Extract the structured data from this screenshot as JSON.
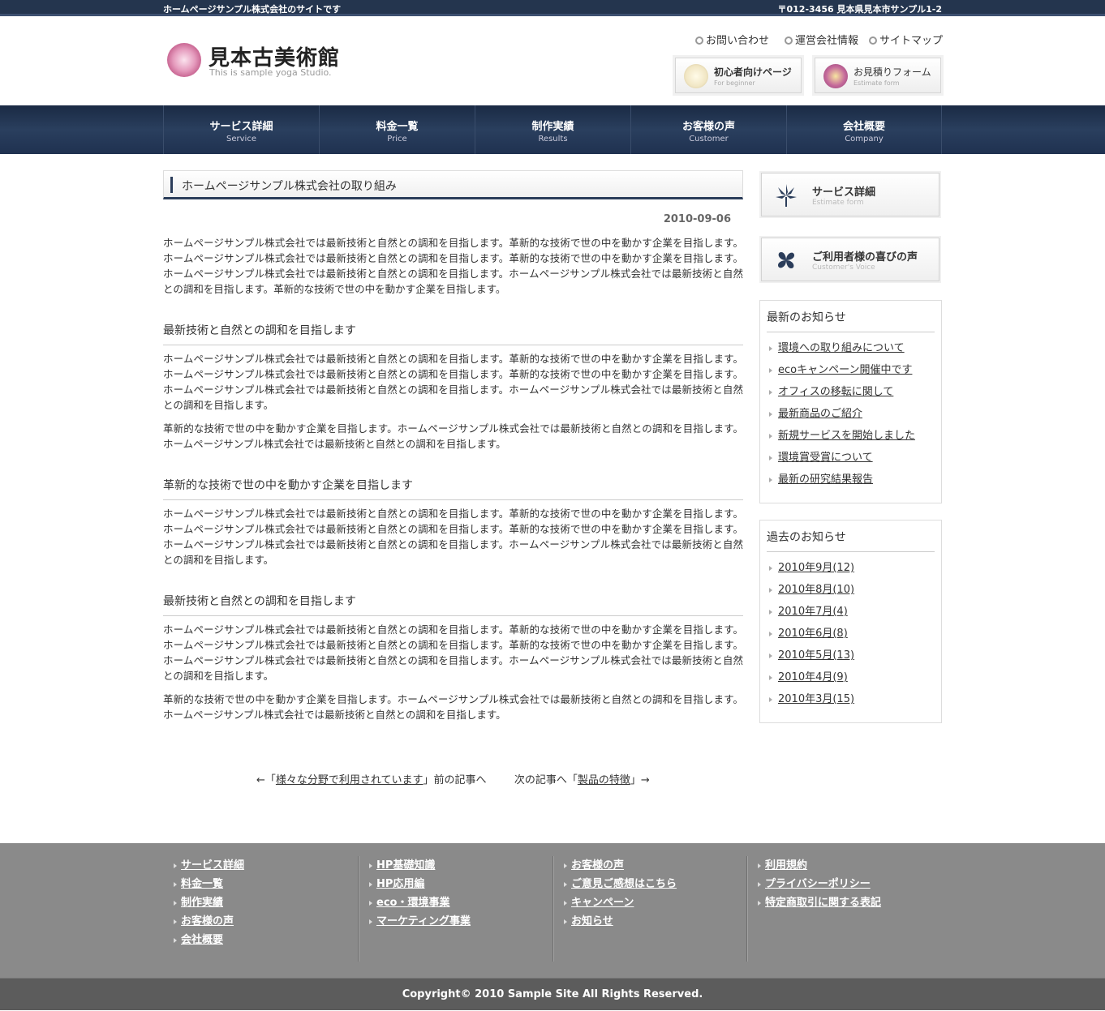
{
  "topbar": {
    "tagline": "ホームページサンプル株式会社のサイトです",
    "address": "〒012-3456 見本県見本市サンプル1-2"
  },
  "header": {
    "logo_title": "見本古美術館",
    "logo_subtitle": "This is sample yoga Studio.",
    "utility_links": [
      "お問い合わせ",
      "運営会社情報",
      "サイトマップ"
    ],
    "buttons": [
      {
        "label": "初心者向けページ",
        "sub": "For beginner"
      },
      {
        "label": "お見積りフォーム",
        "sub": "Estimate form"
      }
    ]
  },
  "nav": [
    {
      "jp": "サービス詳細",
      "en": "Service"
    },
    {
      "jp": "料金一覧",
      "en": "Price"
    },
    {
      "jp": "制作実績",
      "en": "Results"
    },
    {
      "jp": "お客様の声",
      "en": "Customer"
    },
    {
      "jp": "会社概要",
      "en": "Company"
    }
  ],
  "article": {
    "title": "ホームページサンプル株式会社の取り組み",
    "date": "2010-09-06",
    "intro": "ホームページサンプル株式会社では最新技術と自然との調和を目指します。革新的な技術で世の中を動かす企業を目指します。ホームページサンプル株式会社では最新技術と自然との調和を目指します。革新的な技術で世の中を動かす企業を目指します。ホームページサンプル株式会社では最新技術と自然との調和を目指します。ホームページサンプル株式会社では最新技術と自然との調和を目指します。革新的な技術で世の中を動かす企業を目指します。",
    "sections": [
      {
        "heading": "最新技術と自然との調和を目指します",
        "paragraphs": [
          "ホームページサンプル株式会社では最新技術と自然との調和を目指します。革新的な技術で世の中を動かす企業を目指します。ホームページサンプル株式会社では最新技術と自然との調和を目指します。革新的な技術で世の中を動かす企業を目指します。ホームページサンプル株式会社では最新技術と自然との調和を目指します。ホームページサンプル株式会社では最新技術と自然との調和を目指します。",
          "革新的な技術で世の中を動かす企業を目指します。ホームページサンプル株式会社では最新技術と自然との調和を目指します。ホームページサンプル株式会社では最新技術と自然との調和を目指します。"
        ]
      },
      {
        "heading": "革新的な技術で世の中を動かす企業を目指します",
        "paragraphs": [
          "ホームページサンプル株式会社では最新技術と自然との調和を目指します。革新的な技術で世の中を動かす企業を目指します。ホームページサンプル株式会社では最新技術と自然との調和を目指します。革新的な技術で世の中を動かす企業を目指します。ホームページサンプル株式会社では最新技術と自然との調和を目指します。ホームページサンプル株式会社では最新技術と自然との調和を目指します。"
        ]
      },
      {
        "heading": "最新技術と自然との調和を目指します",
        "paragraphs": [
          "ホームページサンプル株式会社では最新技術と自然との調和を目指します。革新的な技術で世の中を動かす企業を目指します。ホームページサンプル株式会社では最新技術と自然との調和を目指します。革新的な技術で世の中を動かす企業を目指します。ホームページサンプル株式会社では最新技術と自然との調和を目指します。ホームページサンプル株式会社では最新技術と自然との調和を目指します。",
          "革新的な技術で世の中を動かす企業を目指します。ホームページサンプル株式会社では最新技術と自然との調和を目指します。ホームページサンプル株式会社では最新技術と自然との調和を目指します。"
        ]
      }
    ]
  },
  "pager": {
    "prev_arrow": "←「",
    "prev_link": "様々な分野で利用されています",
    "prev_suffix": "」前の記事へ",
    "next_prefix": "次の記事へ「",
    "next_link": "製品の特徴",
    "next_arrow": "」→"
  },
  "sidebar": {
    "buttons": [
      {
        "label": "サービス詳細",
        "sub": "Estimate form"
      },
      {
        "label": "ご利用者様の喜びの声",
        "sub": "Customer's Voice"
      }
    ],
    "news_title": "最新のお知らせ",
    "news": [
      "環境への取り組みについて",
      "ecoキャンペーン開催中です",
      "オフィスの移転に関して",
      "最新商品のご紹介",
      "新規サービスを開始しました",
      "環境賞受賞について",
      "最新の研究結果報告"
    ],
    "archive_title": "過去のお知らせ",
    "archive": [
      "2010年9月(12)",
      "2010年8月(10)",
      "2010年7月(4)",
      "2010年6月(8)",
      "2010年5月(13)",
      "2010年4月(9)",
      "2010年3月(15)"
    ]
  },
  "footer": {
    "columns": [
      [
        "サービス詳細",
        "料金一覧",
        "制作実績",
        "お客様の声",
        "会社概要"
      ],
      [
        "HP基礎知識",
        "HP応用編",
        "eco・環境事業",
        "マーケティング事業"
      ],
      [
        "お客様の声",
        "ご意見ご感想はこちら",
        "キャンペーン",
        "お知らせ"
      ],
      [
        "利用規約",
        "プライバシーポリシー",
        "特定商取引に関する表記"
      ]
    ],
    "copyright": "Copyright© 2010 Sample Site All Rights Reserved."
  },
  "colors": {
    "navy": "#24354e",
    "footer": "#8a8a8a",
    "copyright_bar": "#5c5c5c"
  }
}
